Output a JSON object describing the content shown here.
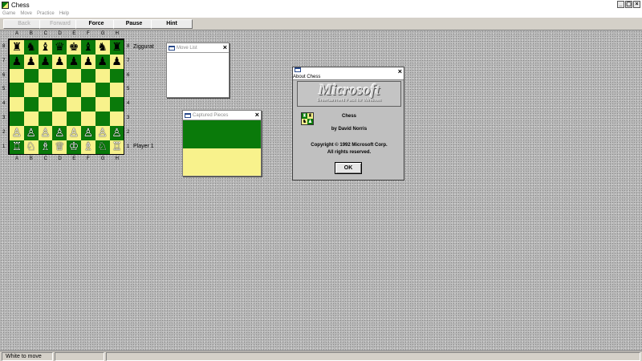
{
  "window": {
    "title": "Chess",
    "controls": [
      "_",
      "▢",
      "×"
    ]
  },
  "menu": [
    "Game",
    "Move",
    "Practice",
    "Help"
  ],
  "toolbar": {
    "back": "Back",
    "forward": "Forward",
    "force": "Force",
    "pause": "Pause",
    "hint": "Hint"
  },
  "board": {
    "files": [
      "A",
      "B",
      "C",
      "D",
      "E",
      "F",
      "G",
      "H"
    ],
    "ranks": [
      "8",
      "7",
      "6",
      "5",
      "4",
      "3",
      "2",
      "1"
    ],
    "top_player": "Ziggurat",
    "bottom_player": "Player 1",
    "rows": [
      [
        "♜",
        "♞",
        "♝",
        "♛",
        "♚",
        "♝",
        "♞",
        "♜"
      ],
      [
        "♟",
        "♟",
        "♟",
        "♟",
        "♟",
        "♟",
        "♟",
        "♟"
      ],
      [
        "",
        "",
        "",
        "",
        "",
        "",
        "",
        ""
      ],
      [
        "",
        "",
        "",
        "",
        "",
        "",
        "",
        ""
      ],
      [
        "",
        "",
        "",
        "",
        "",
        "",
        "",
        ""
      ],
      [
        "",
        "",
        "",
        "",
        "",
        "",
        "",
        ""
      ],
      [
        "♙",
        "♙",
        "♙",
        "♙",
        "♙",
        "♙",
        "♙",
        "♙"
      ],
      [
        "♖",
        "♘",
        "♗",
        "♕",
        "♔",
        "♗",
        "♘",
        "♖"
      ]
    ],
    "dark_color": "#0a7a0a",
    "light_color": "#f8f28c"
  },
  "move_list": {
    "title": "Move List"
  },
  "captured": {
    "title": "Captured Pieces",
    "top_color": "#0a7a0a",
    "bottom_color": "#f8f28c"
  },
  "about": {
    "title": "About Chess",
    "logo": "Microsoft",
    "logo_sub": "Entertainment Pack for Windows",
    "app_name": "Chess",
    "author": "by David Norris",
    "copyright": "Copyright © 1992 Microsoft Corp.",
    "rights": "All rights reserved.",
    "ok": "OK"
  },
  "status": {
    "message": "White to move"
  }
}
